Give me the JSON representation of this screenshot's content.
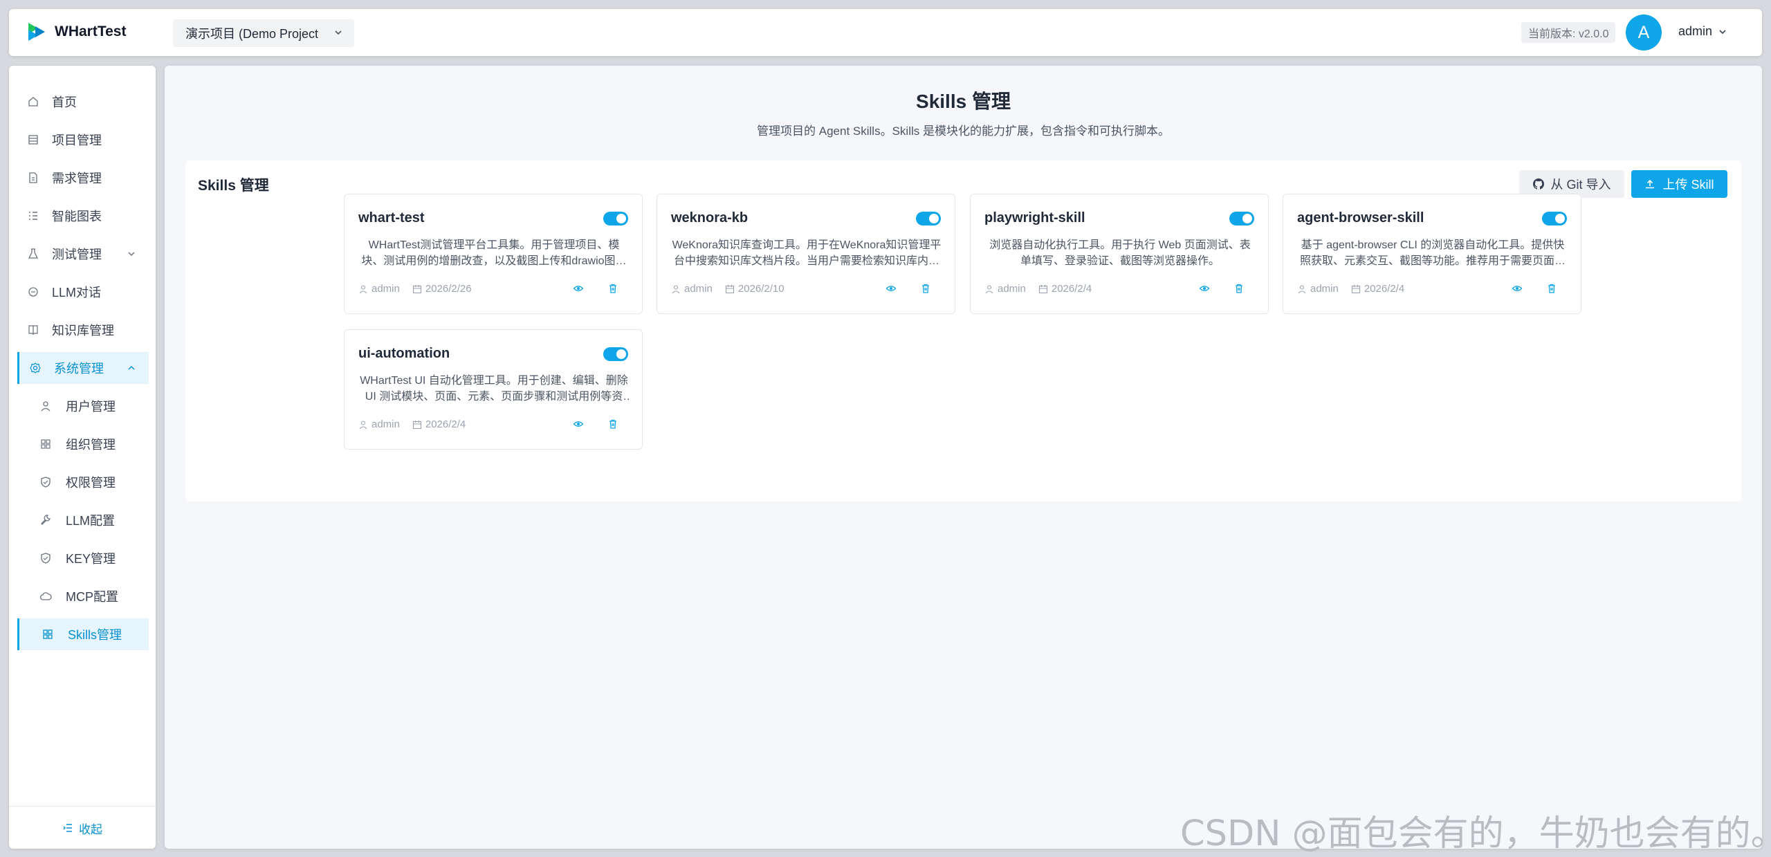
{
  "header": {
    "app_name": "WHartTest",
    "project_select": "演示项目 (Demo Project",
    "version": "当前版本: v2.0.0",
    "avatar_letter": "A",
    "username": "admin"
  },
  "sidebar": {
    "items": [
      {
        "label": "首页",
        "icon": "home-icon"
      },
      {
        "label": "项目管理",
        "icon": "project-icon"
      },
      {
        "label": "需求管理",
        "icon": "document-icon"
      },
      {
        "label": "智能图表",
        "icon": "list-icon"
      },
      {
        "label": "测试管理",
        "icon": "flask-icon"
      },
      {
        "label": "LLM对话",
        "icon": "chat-icon"
      },
      {
        "label": "知识库管理",
        "icon": "book-icon"
      },
      {
        "label": "系统管理",
        "icon": "gear-icon"
      },
      {
        "label": "用户管理",
        "icon": "user-icon"
      },
      {
        "label": "组织管理",
        "icon": "grid-icon"
      },
      {
        "label": "权限管理",
        "icon": "shield-icon"
      },
      {
        "label": "LLM配置",
        "icon": "wrench-icon"
      },
      {
        "label": "KEY管理",
        "icon": "shield-check-icon"
      },
      {
        "label": "MCP配置",
        "icon": "cloud-icon"
      },
      {
        "label": "Skills管理",
        "icon": "apps-icon"
      }
    ],
    "collapse_label": "收起"
  },
  "main": {
    "title": "Skills 管理",
    "subtitle": "管理项目的 Agent Skills。Skills 是模块化的能力扩展，包含指令和可执行脚本。",
    "panel_title": "Skills 管理",
    "git_import_label": "从 Git 导入",
    "upload_label": "上传 Skill",
    "skills": [
      {
        "name": "whart-test",
        "enabled": true,
        "description": "WHartTest测试管理平台工具集。用于管理项目、模块、测试用例的增删改查，以及截图上传和drawio图表等操作。",
        "author": "admin",
        "date": "2026/2/26"
      },
      {
        "name": "weknora-kb",
        "enabled": true,
        "description": "WeKnora知识库查询工具。用于在WeKnora知识管理平台中搜索知识库文档片段。当用户需要检索知识库内容时使用。",
        "author": "admin",
        "date": "2026/2/10"
      },
      {
        "name": "playwright-skill",
        "enabled": true,
        "description": "浏览器自动化执行工具。用于执行 Web 页面测试、表单填写、登录验证、截图等浏览器操作。",
        "author": "admin",
        "date": "2026/2/4"
      },
      {
        "name": "agent-browser-skill",
        "enabled": true,
        "description": "基于 agent-browser CLI 的浏览器自动化工具。提供快照获取、元素交互、截图等功能。推荐用于需要页面交互的场景。",
        "author": "admin",
        "date": "2026/2/4"
      },
      {
        "name": "ui-automation",
        "enabled": true,
        "description": "WHartTest UI 自动化管理工具。用于创建、编辑、删除 UI 测试模块、页面、元素、页面步骤和测试用例等资源。",
        "author": "admin",
        "date": "2026/2/4"
      }
    ]
  },
  "watermark": "CSDN @面包会有的，牛奶也会有的。",
  "colors": {
    "accent": "#0ea5e9",
    "active_bg": "#e6f4fd"
  }
}
